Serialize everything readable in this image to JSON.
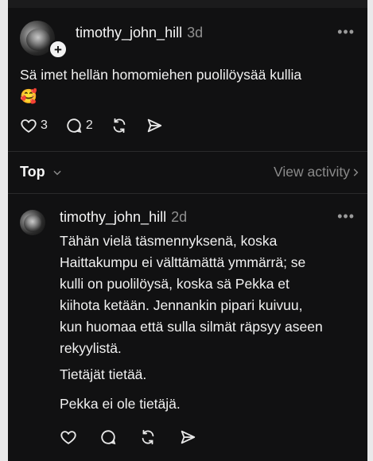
{
  "post": {
    "username": "timothy_john_hill",
    "age": "3d",
    "more": "•••",
    "text": "Sä imet hellän homomiehen puolilöysää kullia\n🥰",
    "likes": "3",
    "replies": "2"
  },
  "sort": {
    "label": "Top",
    "view_activity": "View activity"
  },
  "reply": {
    "username": "timothy_john_hill",
    "age": "2d",
    "more": "•••",
    "paragraph1": "Tähän vielä täsmennyksenä, koska\nHaittakumpu ei välttämättä ymmärrä; se\nkulli on puolilöysä, koska sä Pekka et\nkiihota ketään. Jennankin pipari kuivuu,\nkun huomaa että sulla silmät räpsyy aseen\nrekyylistä.",
    "paragraph2": "Tietäjät tietää.",
    "paragraph3": "Pekka ei ole tietäjä."
  },
  "icons": {
    "like": "heart-icon",
    "comment": "comment-icon",
    "repost": "repost-icon",
    "share": "send-icon",
    "follow": "plus-icon"
  }
}
